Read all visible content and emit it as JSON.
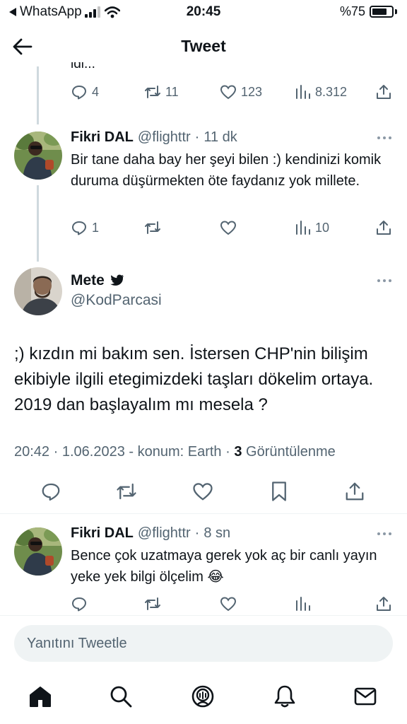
{
  "status_bar": {
    "back_app": "WhatsApp",
    "time": "20:45",
    "battery_text": "%75",
    "battery_level": 0.75
  },
  "header": {
    "title": "Tweet",
    "back_icon": "arrow-left-icon"
  },
  "previous_tweet": {
    "clipped_text": "idi...",
    "replies": "4",
    "retweets": "11",
    "likes": "123",
    "views": "8.312"
  },
  "reply1": {
    "name": "Fikri DAL",
    "handle": "@flighttr",
    "time": "11 dk",
    "text": "Bir tane daha bay her şeyi bilen :) kendinizi komik duruma düşürmekten öte faydanız yok millete.",
    "replies": "1",
    "views": "10"
  },
  "main_tweet": {
    "name": "Mete",
    "handle": "@KodParcasi",
    "text": ";) kızdın mi bakım sen. İstersen CHP'nin bilişim ekibiyle ilgili etegimizdeki taşları dökelim ortaya. 2019 dan başlayalım mı mesela ?",
    "time": "20:42",
    "date": "1.06.2023",
    "location": "konum: Earth",
    "views_count": "3",
    "views_label": "Görüntülenme"
  },
  "reply2": {
    "name": "Fikri DAL",
    "handle": "@flighttr",
    "time": "8 sn",
    "text": "Bence çok uzatmaya gerek yok aç bir canlı yayın yeke yek bilgi ölçelim 😂"
  },
  "composer": {
    "placeholder": "Yanıtını Tweetle"
  },
  "bottom_nav": [
    "home-icon",
    "search-icon",
    "spaces-icon",
    "notifications-icon",
    "messages-icon"
  ],
  "colors": {
    "secondary_text": "#536471",
    "primary_text": "#0f1419",
    "divider": "#eff3f4",
    "thread_line": "#cfd9de"
  }
}
